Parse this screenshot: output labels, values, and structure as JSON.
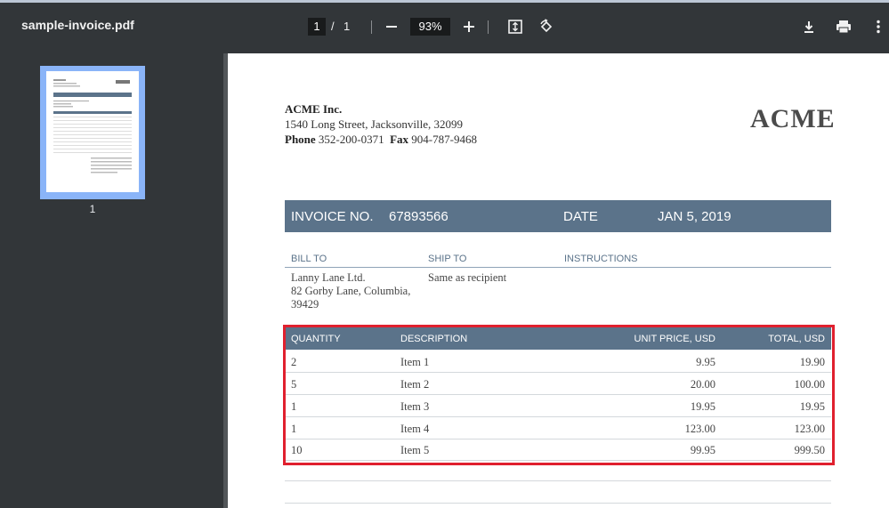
{
  "toolbar": {
    "title": "sample-invoice.pdf",
    "page_current": "1",
    "page_separator": "/",
    "page_total": "1",
    "zoom": "93%"
  },
  "sidebar": {
    "thumbnail_label": "1"
  },
  "invoice": {
    "company_name": "ACME Inc.",
    "address": "1540  Long Street, Jacksonville, 32099",
    "phone_label": "Phone",
    "phone": "352-200-0371",
    "fax_label": "Fax",
    "fax": "904-787-9468",
    "logo": "ACME",
    "invoice_no_label": "INVOICE NO.",
    "invoice_no": "67893566",
    "date_label": "DATE",
    "date": "JAN 5, 2019",
    "bill_to_label": "BILL TO",
    "ship_to_label": "SHIP TO",
    "instructions_label": "INSTRUCTIONS",
    "bill_to": [
      "Lanny Lane Ltd.",
      "82  Gorby Lane, Columbia,",
      "39429"
    ],
    "ship_to": "Same as recipient",
    "table": {
      "headers": [
        "QUANTITY",
        "DESCRIPTION",
        "UNIT PRICE, USD",
        "TOTAL, USD"
      ],
      "rows": [
        {
          "qty": "2",
          "desc": "Item 1",
          "unit": "9.95",
          "total": "19.90"
        },
        {
          "qty": "5",
          "desc": "Item 2",
          "unit": "20.00",
          "total": "100.00"
        },
        {
          "qty": "1",
          "desc": "Item 3",
          "unit": "19.95",
          "total": "19.95"
        },
        {
          "qty": "1",
          "desc": "Item 4",
          "unit": "123.00",
          "total": "123.00"
        },
        {
          "qty": "10",
          "desc": "Item 5",
          "unit": "99.95",
          "total": "999.50"
        }
      ]
    }
  },
  "colors": {
    "toolbar_bg": "#323639",
    "accent_band": "#5b738a",
    "highlight": "#e0202e",
    "thumbnail_selected": "#8ab4f8"
  }
}
